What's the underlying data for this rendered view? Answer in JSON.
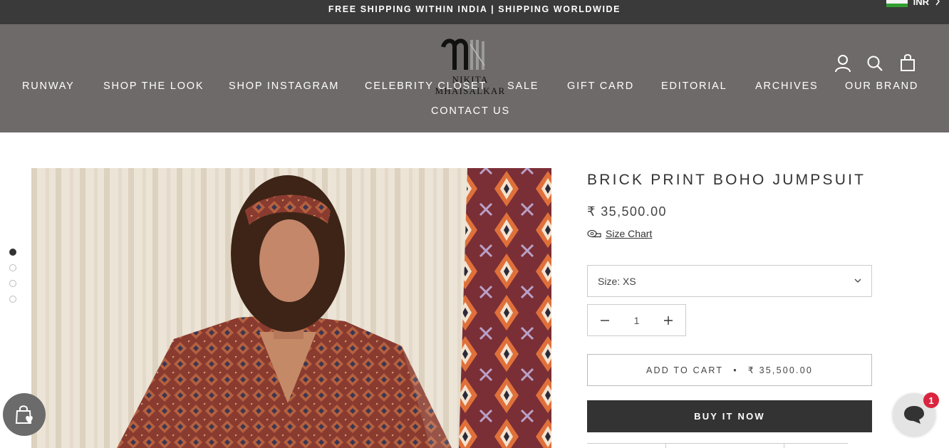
{
  "announcement": {
    "text": "FREE SHIPPING WITHIN INDIA | SHIPPING WORLDWIDE",
    "currency_code": "INR",
    "currency_flag_icon": "india-flag-icon",
    "chevron_icon": "chevron-right-icon"
  },
  "header": {
    "logo_text": "NIKITA MHAISALKAR",
    "nav": [
      {
        "label": "RUNWAY"
      },
      {
        "label": "SHOP THE LOOK"
      },
      {
        "label": "SHOP INSTAGRAM"
      },
      {
        "label": "CELEBRITY CLOSET"
      },
      {
        "label": "SALE"
      },
      {
        "label": "GIFT CARD"
      },
      {
        "label": "EDITORIAL"
      },
      {
        "label": "ARCHIVES"
      },
      {
        "label": "OUR BRAND"
      },
      {
        "label": "CONTACT US"
      }
    ],
    "icons": [
      "account-icon",
      "search-icon",
      "shopping-bag-icon"
    ]
  },
  "gallery": {
    "image_count": 4,
    "active_index": 0
  },
  "product": {
    "title": "BRICK PRINT BOHO JUMPSUIT",
    "price": "₹ 35,500.00",
    "size_chart_label": "Size Chart",
    "size_label": "Size: XS",
    "quantity": "1",
    "add_to_cart_label": "ADD TO CART",
    "separator": "•",
    "add_to_cart_price": "₹ 35,500.00",
    "buy_now_label": "BUY IT NOW"
  },
  "widgets": {
    "chat_badge_count": "1"
  },
  "colors": {
    "announcement_bg": "#3b3a3a",
    "header_bg": "#6e6a69",
    "buy_now_bg": "#333333",
    "chat_badge": "#d9253f"
  }
}
